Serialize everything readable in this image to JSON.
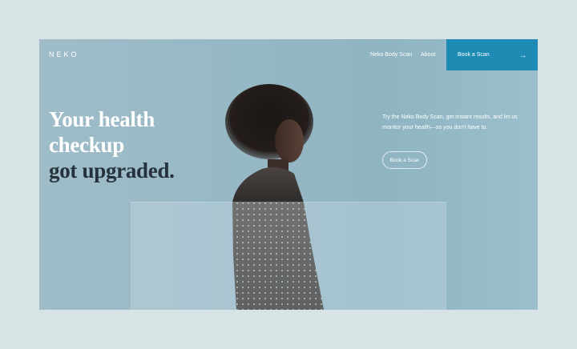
{
  "header": {
    "logo": "NEKO",
    "nav": [
      {
        "label": "Neko Body Scan"
      },
      {
        "label": "About"
      }
    ],
    "cta": {
      "label": "Book a Scan",
      "icon": "arrow-right-icon"
    }
  },
  "hero": {
    "title_lines": [
      "Your health",
      "checkup",
      "got upgraded."
    ],
    "blurb": "Try the Neko Body Scan, get instant results, and let us monitor your health—so you don't have to.",
    "button_label": "Book a Scan"
  },
  "colors": {
    "accent": "#1e8bb5",
    "background": "#9fbcc8",
    "title_dark": "#26323a"
  }
}
